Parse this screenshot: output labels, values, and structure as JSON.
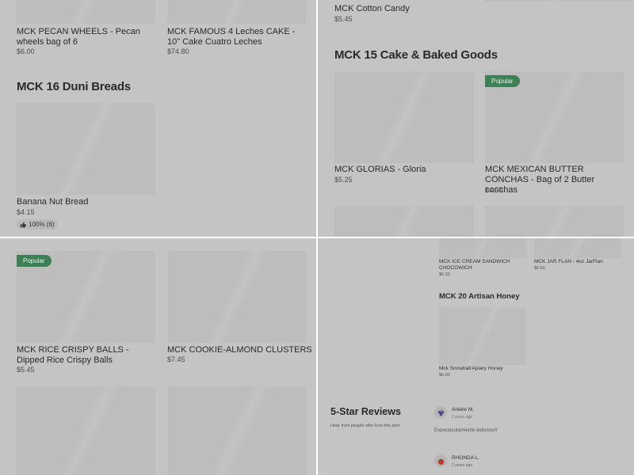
{
  "quad_top_left": {
    "top_products": [
      {
        "name": "MCK PECAN WHEELS - Pecan wheels bag of 6",
        "price": "$6.00"
      },
      {
        "name": "MCK FAMOUS 4 Leches CAKE - 10\" Cake Cuatro Leches",
        "price": "$74.80"
      }
    ],
    "section_title": "MCK 16 Duni Breads",
    "product": {
      "name": "Banana Nut Bread",
      "price": "$4.15",
      "rating": "100% (6)"
    }
  },
  "quad_top_right": {
    "top_product": {
      "name": "MCK Cotton Candy",
      "price": "$5.45"
    },
    "section_title": "MCK 15 Cake & Baked Goods",
    "products": [
      {
        "name": "MCK GLORIAS - Gloria",
        "price": "$5.25"
      },
      {
        "name": "MCK MEXICAN BUTTER CONCHAS - Bag of 2 Butter conchas",
        "price": "$4.95",
        "badge": "Popular"
      }
    ]
  },
  "quad_bottom_left": {
    "badge": "Popular",
    "products": [
      {
        "name": "MCK RICE CRISPY BALLS - Dipped Rice Crispy Balls",
        "price": "$5.45"
      },
      {
        "name": "MCK COOKIE-ALMOND CLUSTERS",
        "price": "$7.45"
      }
    ]
  },
  "quad_bottom_right": {
    "top_products": [
      {
        "name": "MCK ICE CREAM SANDWICH CHOCOWICH",
        "price": "$6.35"
      },
      {
        "name": "MCK JAR FLAN - 4oz JarFlan",
        "price": "$6.60"
      }
    ],
    "section_title": "MCK 20 Artisan Honey",
    "honey_product": {
      "name": "Mck Snowball Apiary Honey",
      "price": "$6.60"
    },
    "reviews_title": "5-Star Reviews",
    "reviews_subtitle": "Hear from people who love this spot",
    "reviews": [
      {
        "name": "Anlelis M.",
        "time": "2 years ago",
        "text": "Espectacularmente delicioso!!",
        "avatar_icon": "grapes-icon"
      },
      {
        "name": "RHONDA L.",
        "time": "2 years ago",
        "avatar_icon": "tomato-icon"
      }
    ]
  }
}
